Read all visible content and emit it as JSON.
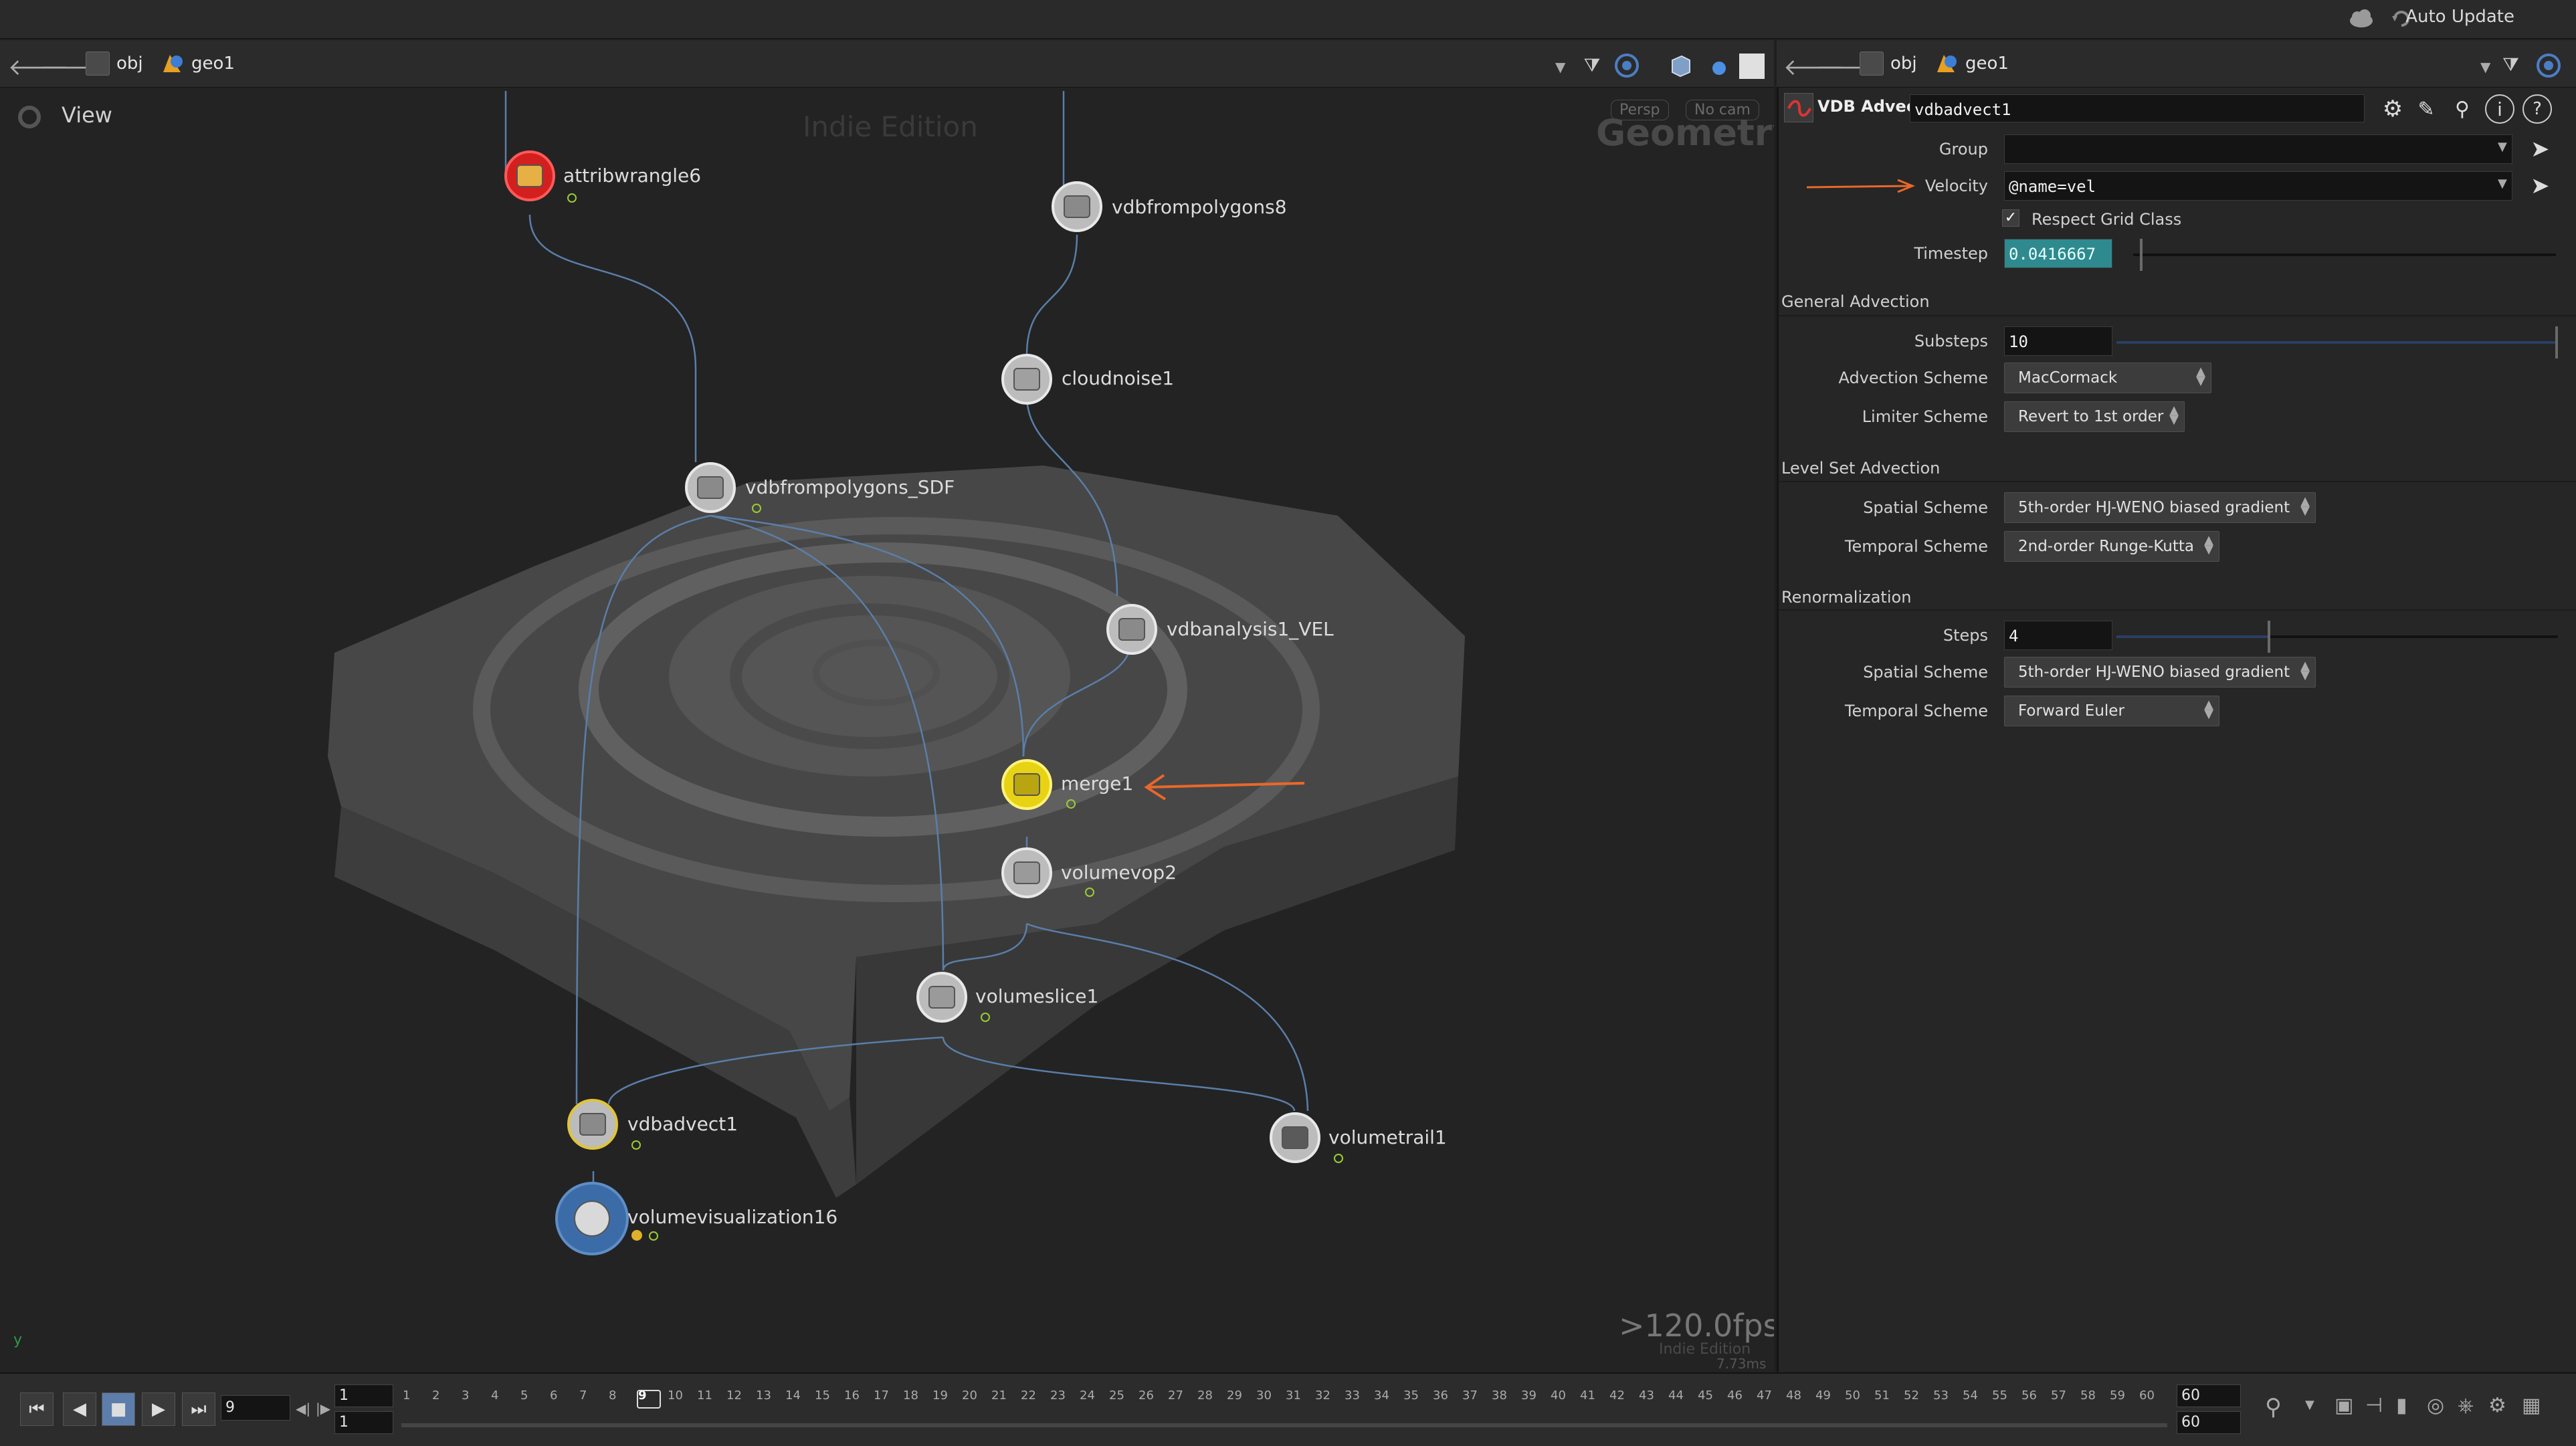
{
  "statusbar": {
    "auto_update": "Auto Update"
  },
  "left_path": {
    "obj": "obj",
    "geo": "geo1"
  },
  "right_path": {
    "obj": "obj",
    "geo": "geo1"
  },
  "viewport": {
    "view_label": "View",
    "watermark": "Indie Edition",
    "camera_persp": "Persp",
    "camera_nocam": "No cam",
    "context": "Geometry",
    "fps": ">120.0fps",
    "fps_sub1": "Indie Edition",
    "fps_sub2": "7.73ms",
    "axis": "y"
  },
  "nodes": [
    {
      "name": "attribwrangle6",
      "color": "#d3201f"
    },
    {
      "name": "vdbfrompolygons8",
      "color": "#bcbcbc"
    },
    {
      "name": "cloudnoise1",
      "color": "#bcbcbc"
    },
    {
      "name": "vdbfrompolygons_SDF",
      "color": "#bcbcbc"
    },
    {
      "name": "vdbanalysis1_VEL",
      "color": "#bcbcbc"
    },
    {
      "name": "merge1",
      "color": "#e8d214"
    },
    {
      "name": "volumevop2",
      "color": "#bcbcbc"
    },
    {
      "name": "volumeslice1",
      "color": "#bcbcbc"
    },
    {
      "name": "vdbadvect1",
      "color": "#bcbcbc"
    },
    {
      "name": "volumetrail1",
      "color": "#bcbcbc"
    },
    {
      "name": "volumevisualization16",
      "color": "#3c6ca8"
    }
  ],
  "params": {
    "node_type": "VDB Advect",
    "node_name": "vdbadvect1",
    "group_label": "Group",
    "group_value": "",
    "velocity_label": "Velocity",
    "velocity_value": "@name=vel",
    "respect_grid": "Respect Grid Class",
    "timestep_label": "Timestep",
    "timestep_value": "0.0416667",
    "sec_general": "General Advection",
    "substeps_label": "Substeps",
    "substeps_value": "10",
    "adv_scheme_label": "Advection Scheme",
    "adv_scheme_value": "MacCormack",
    "limiter_label": "Limiter Scheme",
    "limiter_value": "Revert to 1st order",
    "sec_levelset": "Level Set Advection",
    "spatial_label": "Spatial Scheme",
    "spatial_value": "5th-order HJ-WENO biased gradient",
    "temporal_label": "Temporal Scheme",
    "temporal_value": "2nd-order Runge-Kutta",
    "sec_renorm": "Renormalization",
    "steps_label": "Steps",
    "steps_value": "4",
    "spatial2_label": "Spatial Scheme",
    "spatial2_value": "5th-order HJ-WENO biased gradient",
    "temporal2_label": "Temporal Scheme",
    "temporal2_value": "Forward Euler"
  },
  "timeline": {
    "current_frame": "9",
    "start_top": "1",
    "start_bottom": "1",
    "end_top": "60",
    "end_bottom": "60",
    "ticks": [
      "1",
      "2",
      "3",
      "4",
      "5",
      "6",
      "7",
      "8",
      "9",
      "10",
      "11",
      "12",
      "13",
      "14",
      "15",
      "16",
      "17",
      "18",
      "19",
      "20",
      "21",
      "22",
      "23",
      "24",
      "25",
      "26",
      "27",
      "28",
      "29",
      "30",
      "31",
      "32",
      "33",
      "34",
      "35",
      "36",
      "37",
      "38",
      "39",
      "40",
      "41",
      "42",
      "43",
      "44",
      "45",
      "46",
      "47",
      "48",
      "49",
      "50",
      "51",
      "52",
      "53",
      "54",
      "55",
      "56",
      "57",
      "58",
      "59",
      "60"
    ]
  },
  "annotations": {
    "arrow_color": "#e8682a"
  }
}
